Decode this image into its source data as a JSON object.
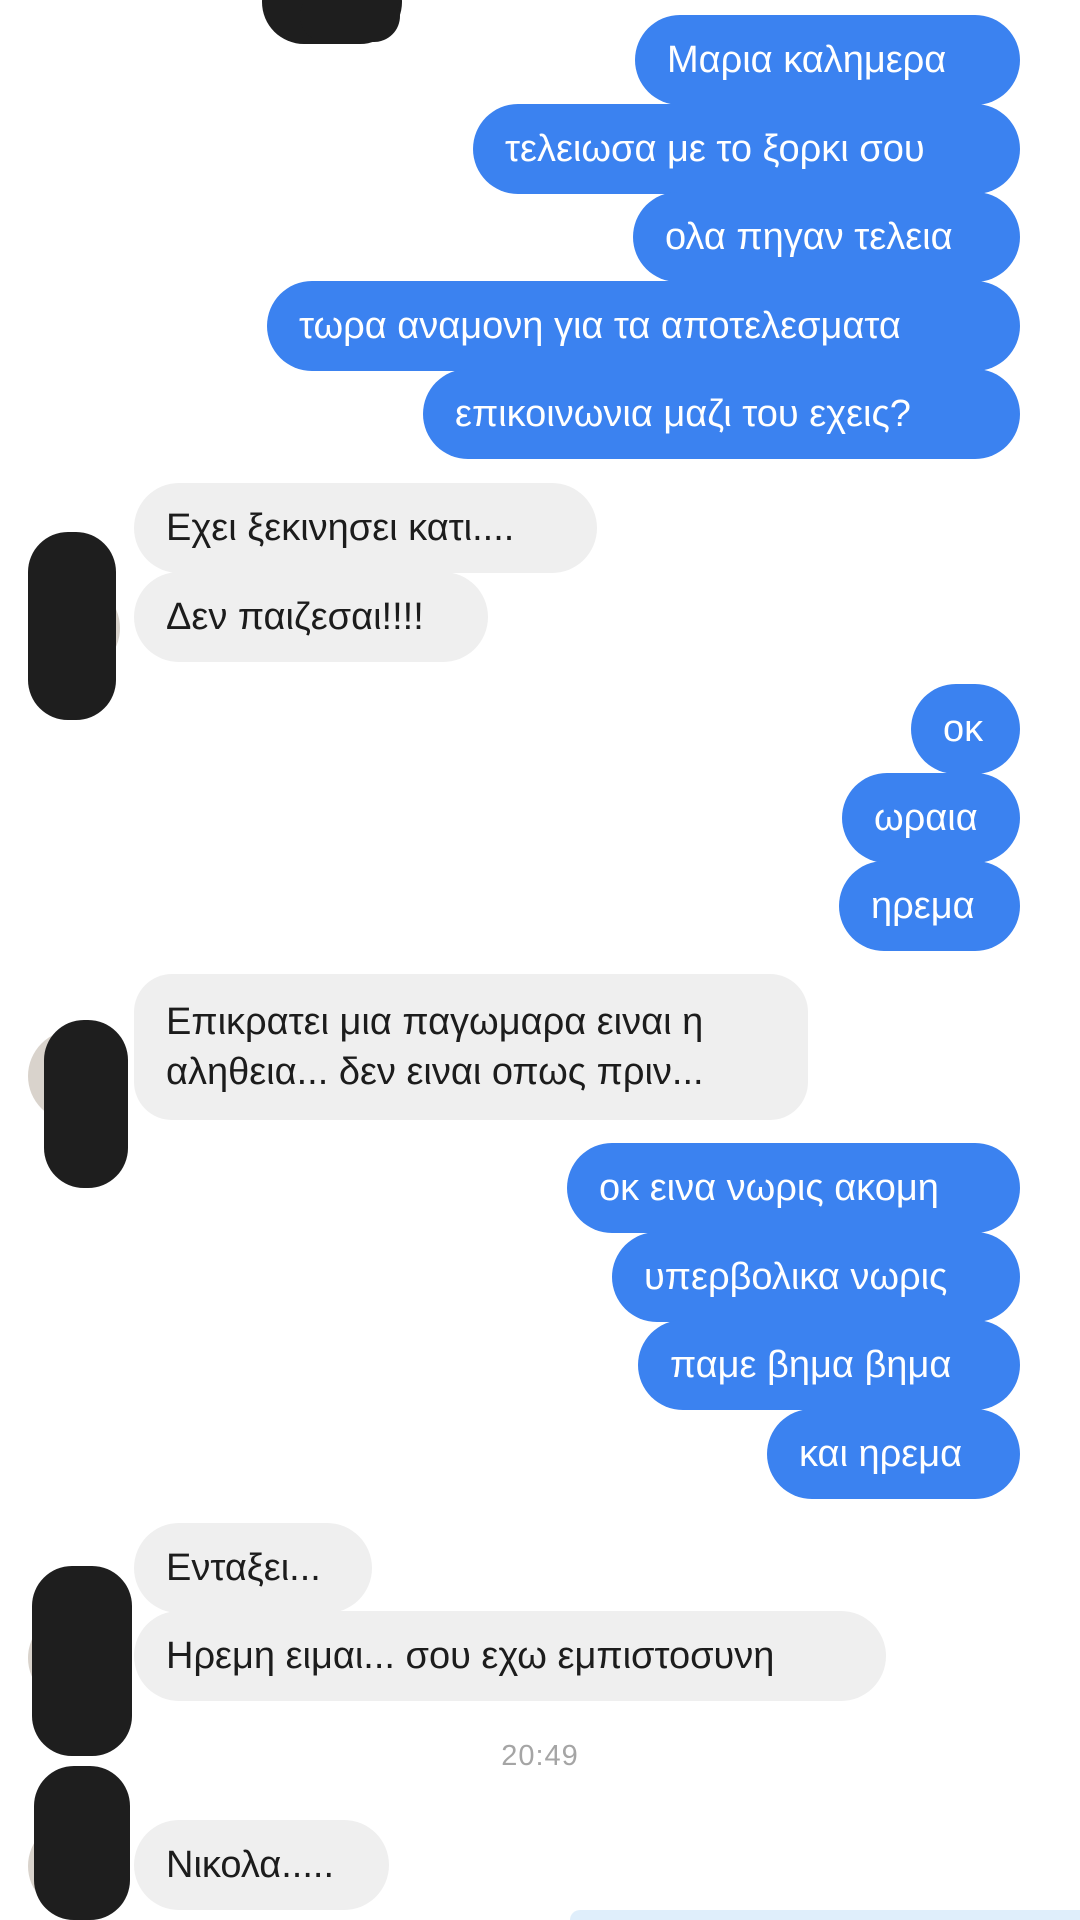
{
  "outgoing_group_1": [
    "Μαρια καλημερα",
    "τελειωσα με το ξορκι σου",
    "ολα πηγαν τελεια",
    "τωρα αναμονη για τα αποτελεσματα",
    "επικοινωνια μαζι του  εχεις?"
  ],
  "incoming_group_1": [
    "Εχει ξεκινησει κατι....",
    "Δεν παιζεσαι!!!!"
  ],
  "outgoing_group_2": [
    "οκ",
    "ωραια",
    "ηρεμα"
  ],
  "incoming_group_2": [
    "Επικρατει μια παγωμαρα ειναι η αληθεια... δεν ειναι οπως πριν..."
  ],
  "outgoing_group_3": [
    "οκ εινα νωρις ακομη",
    "υπερβολικα νωρις",
    "παμε βημα βημα",
    "και ηρεμα"
  ],
  "incoming_group_3": [
    "Ενταξει...",
    "Ηρεμη ειμαι... σου εχω εμπιστοσυνη"
  ],
  "timestamp": "20:49",
  "incoming_group_4": [
    "Νικολα....."
  ],
  "colors": {
    "outgoing_bubble": "#3b82f0",
    "incoming_bubble": "#efefef",
    "redaction": "#1e1e1e"
  }
}
